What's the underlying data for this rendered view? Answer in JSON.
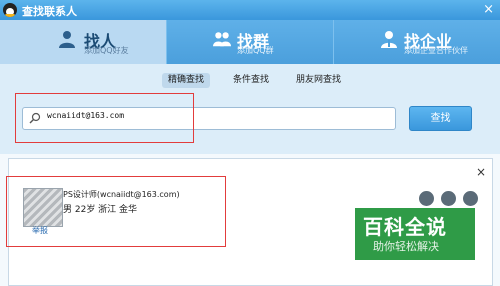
{
  "window": {
    "title": "查找联系人",
    "close_glyph": "×"
  },
  "tabs": [
    {
      "label": "找人",
      "sub": "添加QQ好友",
      "icon": "person-icon"
    },
    {
      "label": "找群",
      "sub": "添加QQ群",
      "icon": "group-icon"
    },
    {
      "label": "找企业",
      "sub": "添加企业合作伙伴",
      "icon": "enterprise-icon"
    }
  ],
  "subtabs": [
    "精确查找",
    "条件查找",
    "朋友网查找"
  ],
  "search": {
    "value": "wcnaiidt@163.com",
    "button": "查找"
  },
  "result": {
    "close_glyph": "×",
    "nickname": "PS设计师(wcnaiidt@163.com)",
    "info": "男 22岁 浙江 金华",
    "report": "举报"
  },
  "watermark": {
    "main": "百科全说",
    "sub": "助你轻松解决"
  },
  "colors": {
    "accent": "#3a97dc",
    "highlight_box": "#e23c3c",
    "watermark": "#2f9b47"
  }
}
